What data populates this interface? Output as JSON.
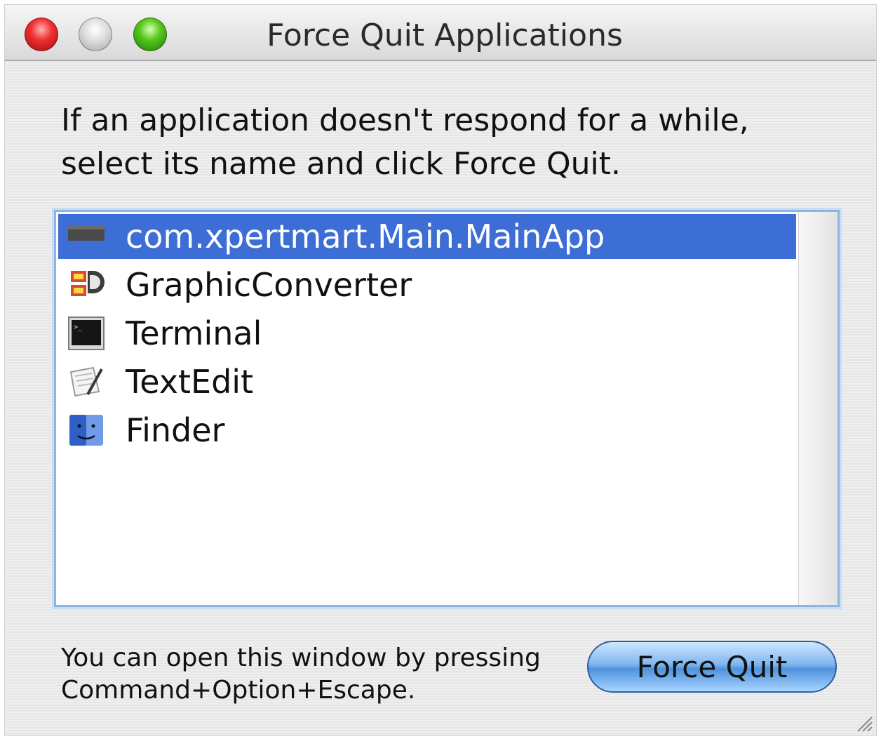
{
  "window": {
    "title": "Force Quit Applications",
    "buttons": {
      "close": "close-icon",
      "minimize": "minimize-icon",
      "zoom": "zoom-icon"
    }
  },
  "prompt": {
    "line1": "If an application doesn't respond for a while,",
    "line2": "select its name and click Force Quit."
  },
  "apps": [
    {
      "name": "com.xpertmart.Main.MainApp",
      "icon": "java-app-icon",
      "selected": true
    },
    {
      "name": "GraphicConverter",
      "icon": "graphicconverter-icon",
      "selected": false
    },
    {
      "name": "Terminal",
      "icon": "terminal-icon",
      "selected": false
    },
    {
      "name": "TextEdit",
      "icon": "textedit-icon",
      "selected": false
    },
    {
      "name": "Finder",
      "icon": "finder-icon",
      "selected": false
    }
  ],
  "hint": {
    "line1": "You can open this window by pressing",
    "line2": "Command+Option+Escape."
  },
  "force_quit_label": "Force Quit",
  "colors": {
    "selection": "#3d6ed6",
    "button": "#6aa6e8",
    "focus_ring": "#8fb4e2"
  }
}
